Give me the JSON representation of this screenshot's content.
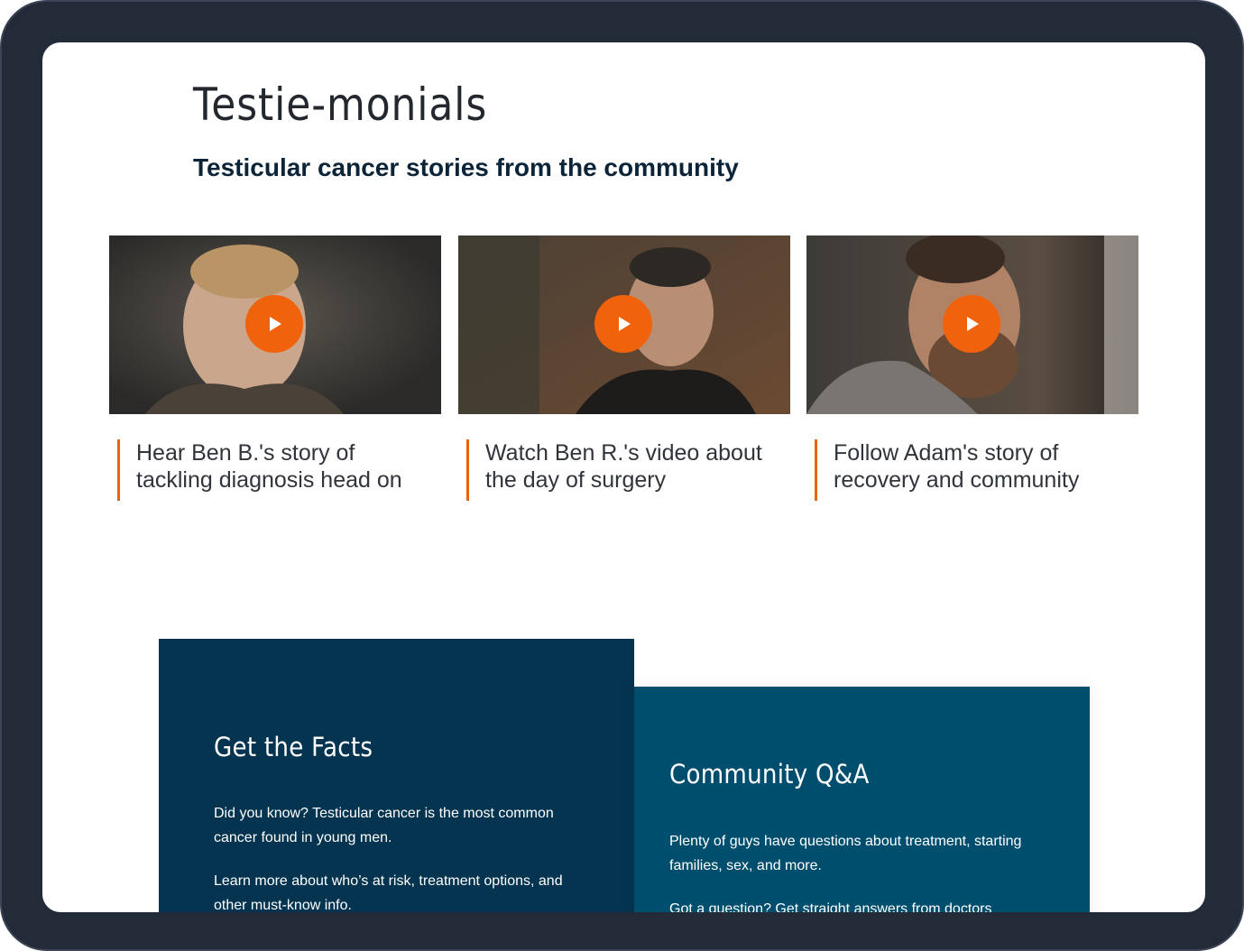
{
  "header": {
    "title": "Testie-monials",
    "subtitle": "Testicular cancer stories from the community"
  },
  "videos": [
    {
      "caption_line1": "Hear Ben B.'s story of",
      "caption_line2": "tackling diagnosis head on",
      "icon": "play-icon"
    },
    {
      "caption_line1": "Watch Ben R.'s video about",
      "caption_line2": "the day of surgery",
      "icon": "play-icon"
    },
    {
      "caption_line1": "Follow Adam's story of",
      "caption_line2": "recovery and community",
      "icon": "play-icon"
    }
  ],
  "facts": {
    "title": "Get the Facts",
    "p1": "Did you know? Testicular cancer is the most common cancer found in young men.",
    "p2": "Learn more about who’s at risk, treatment options, and other must-know info."
  },
  "qa": {
    "title": "Community Q&A",
    "p1": "Plenty of guys have questions about treatment, starting families, sex, and more.",
    "p2": "Got a question? Get straight answers from doctors"
  },
  "colors": {
    "accent": "#f0620c",
    "panel_dark": "#04344f",
    "panel_teal": "#004e6e",
    "frame": "#232a38"
  }
}
